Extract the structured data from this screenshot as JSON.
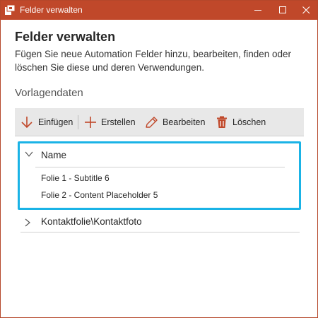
{
  "window": {
    "title": "Felder verwalten",
    "accent_color": "#c0482a",
    "focus_color": "#1ab3e6",
    "icon": "powerpoint-app-icon",
    "controls": [
      "minimize-icon",
      "maximize-icon",
      "close-icon"
    ]
  },
  "header": {
    "title": "Felder verwalten",
    "description": "Fügen Sie neue Automation Felder hinzu, bearbeiten, finden oder löschen Sie diese und deren Verwendungen."
  },
  "section": {
    "title": "Vorlagendaten"
  },
  "toolbar": {
    "insert_label": "Einfügen",
    "insert_icon": "arrow-down-icon",
    "create_label": "Erstellen",
    "create_icon": "plus-icon",
    "edit_label": "Bearbeiten",
    "edit_icon": "pencil-icon",
    "delete_label": "Löschen",
    "delete_icon": "trash-icon"
  },
  "groups": [
    {
      "name": "Name",
      "expanded": true,
      "selected": true,
      "items": [
        "Folie 1 - Subtitle 6",
        "Folie 2 - Content Placeholder 5"
      ]
    },
    {
      "name": "Kontaktfolie\\Kontaktfoto",
      "expanded": false,
      "items": []
    }
  ]
}
